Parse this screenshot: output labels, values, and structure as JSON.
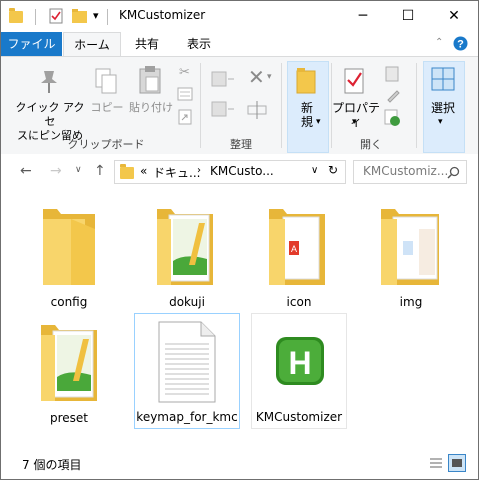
{
  "window": {
    "title": "KMCustomizer",
    "quick_access_menu": "▾",
    "minimize": "─",
    "maximize": "☐",
    "close": "✕"
  },
  "tabs": {
    "file": "ファイル",
    "home": "ホーム",
    "share": "共有",
    "view": "表示"
  },
  "ribbon": {
    "pin": [
      "クイック アクセ",
      "スにピン留め"
    ],
    "copy": "コピー",
    "paste": "貼り付け",
    "clipboard_group": "クリップボード",
    "organize_group": "整理",
    "new": [
      "新",
      "規"
    ],
    "properties": "プロパティ",
    "open_group": "開く",
    "select": "選択"
  },
  "address": {
    "path_prefix": "«",
    "crumb1": "ドキュ...",
    "crumb2": "KMCusto...",
    "search_placeholder": "KMCustomiz..."
  },
  "items": [
    {
      "name": "config",
      "type": "folder"
    },
    {
      "name": "dokuji",
      "type": "folder-images"
    },
    {
      "name": "icon",
      "type": "folder-doc"
    },
    {
      "name": "img",
      "type": "folder-images2"
    },
    {
      "name": "preset",
      "type": "folder-images"
    },
    {
      "name": "keymap_for_kmc",
      "type": "text-file"
    },
    {
      "name": "KMCustomizer",
      "type": "app"
    }
  ],
  "status": {
    "count": "7 個の項目"
  },
  "colors": {
    "accent": "#1979ca",
    "folder": "#f3c74b",
    "app_green": "#2e8b20"
  }
}
